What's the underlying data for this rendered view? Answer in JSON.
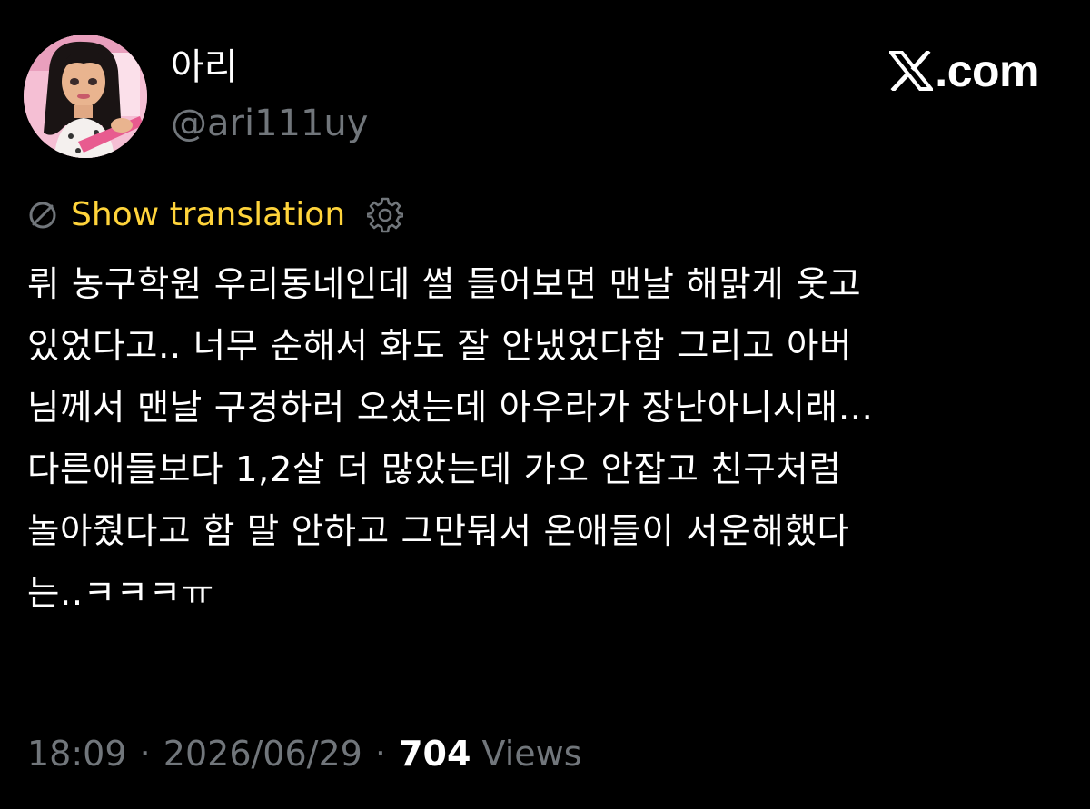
{
  "author": {
    "display_name": "아리",
    "handle": "@ari111uy",
    "avatar_icon": "profile-avatar-cartoon-doll"
  },
  "brand": {
    "logo_icon": "x-logo-icon",
    "domain_suffix": ".com"
  },
  "translation": {
    "icon": "no-translate-icon",
    "label": "Show translation",
    "settings_icon": "gear-icon",
    "color": "#ffd43b"
  },
  "tweet": {
    "lines": [
      "뤼 농구학원 우리동네인데 썰 들어보면 맨날 해맑게 웃고",
      "있었다고.. 너무 순해서 화도 잘 안냈었다함 그리고 아버",
      "님께서 맨날 구경하러 오셨는데 아우라가 장난아니시래…",
      "다른애들보다 1,2살 더 많았는데 가오 안잡고 친구처럼",
      "놀아줬다고 함 말 안하고 그만둬서 온애들이 서운해했다",
      "는..ㅋㅋㅋㅠ"
    ]
  },
  "meta": {
    "time": "18:09",
    "separator": "·",
    "date": "2026/06/29",
    "views_count": "704",
    "views_label": "Views"
  },
  "colors": {
    "background": "#000000",
    "text": "#ffffff",
    "muted": "#71767b",
    "accent": "#ffd43b"
  }
}
